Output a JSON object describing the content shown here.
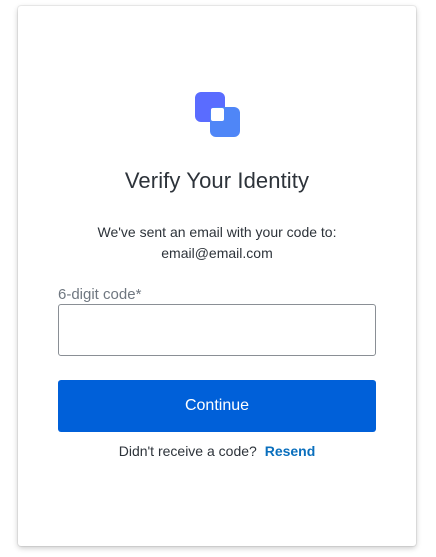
{
  "colors": {
    "primary": "#0060d9",
    "link": "#0a6fbd",
    "text": "#2d333a",
    "muted": "#6f7780",
    "logo_back": "#5a6cff",
    "logo_front": "#4f86f7"
  },
  "logo": {
    "icon": "overlapping-squares-logo-icon"
  },
  "header": {
    "title": "Verify Your Identity",
    "description_line1": "We've sent an email with your code to:",
    "email": "email@email.com"
  },
  "form": {
    "code_label": "6-digit code",
    "required_marker": "*",
    "code_value": "",
    "code_placeholder": "",
    "continue_label": "Continue"
  },
  "footer": {
    "prompt": "Didn't receive a code?",
    "resend_label": "Resend"
  }
}
